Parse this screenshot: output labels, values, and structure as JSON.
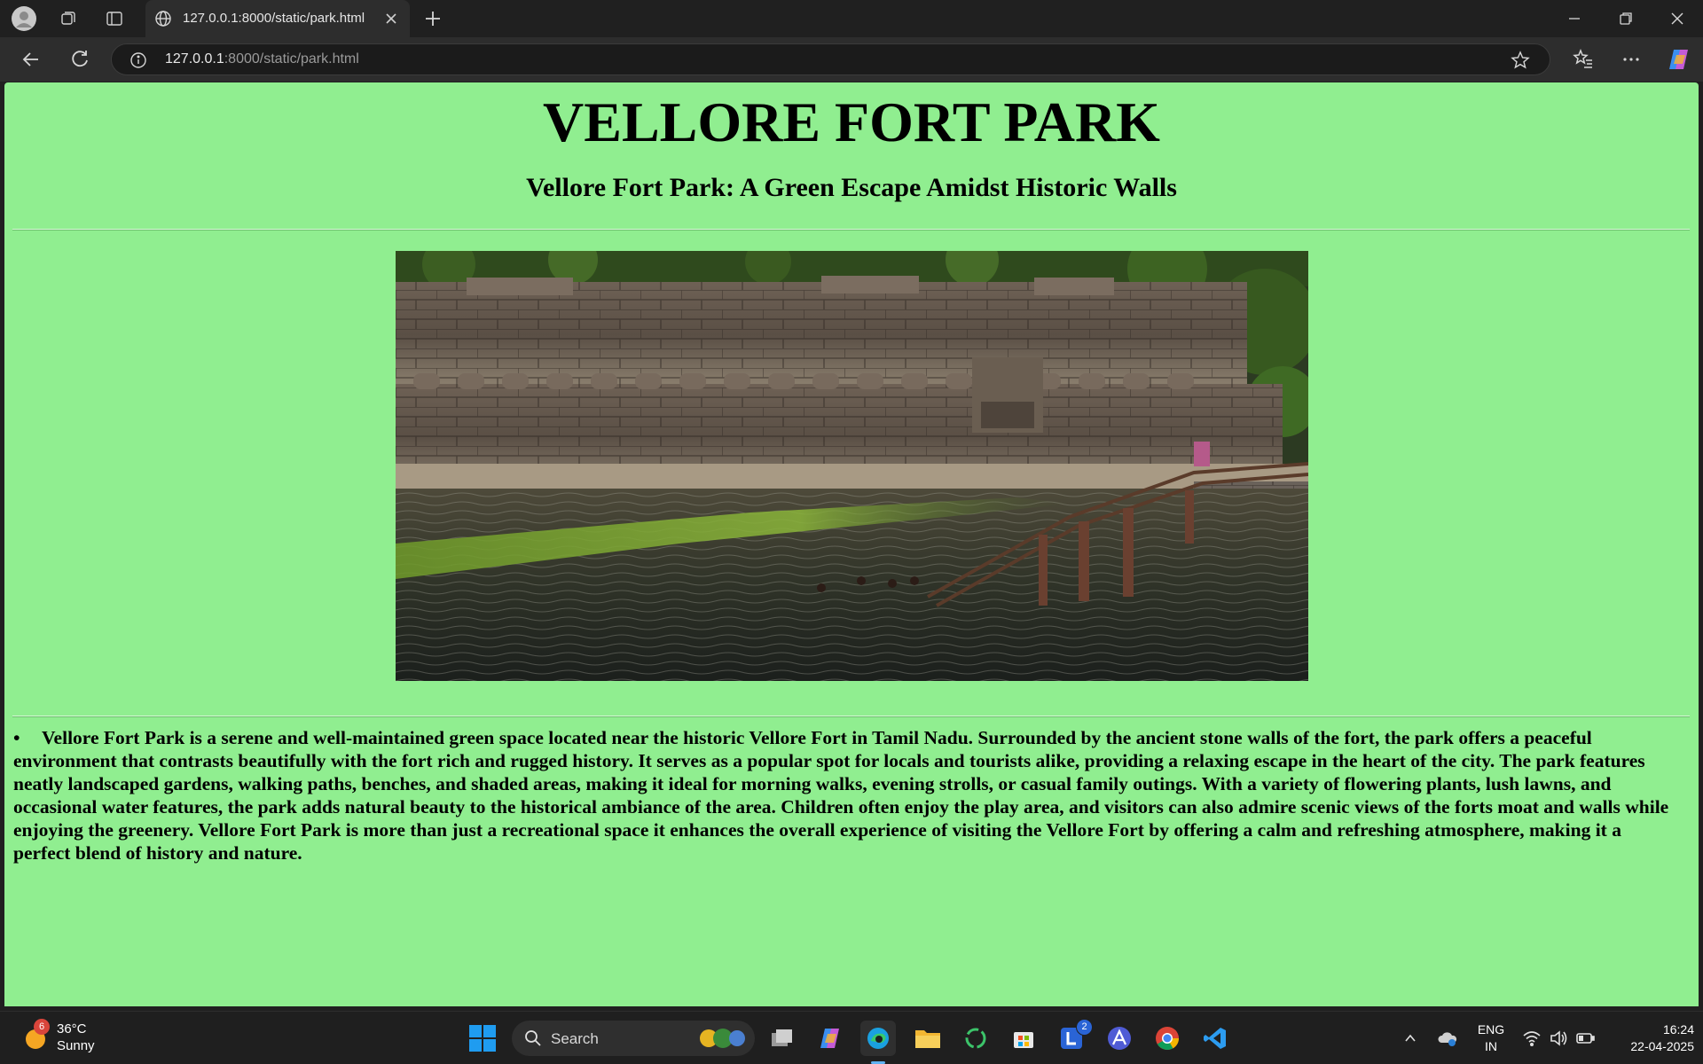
{
  "browser": {
    "tab_title": "127.0.0.1:8000/static/park.html",
    "url_host": "127.0.0.1",
    "url_path": ":8000/static/park.html"
  },
  "page": {
    "title": "VELLORE FORT PARK",
    "subtitle": "Vellore Fort Park: A Green Escape Amidst Historic Walls",
    "bullet": "•",
    "paragraph": "Vellore Fort Park is a serene and well-maintained green space located near the historic Vellore Fort in Tamil Nadu. Surrounded by the ancient stone walls of the fort, the park offers a peaceful environment that contrasts beautifully with the fort rich and rugged history. It serves as a popular spot for locals and tourists alike, providing a relaxing escape in the heart of the city. The park features neatly landscaped gardens, walking paths, benches, and shaded areas, making it ideal for morning walks, evening strolls, or casual family outings. With a variety of flowering plants, lush lawns, and occasional water features, the park adds natural beauty to the historical ambiance of the area. Children often enjoy the play area, and visitors can also admire scenic views of the forts moat and walls while enjoying the greenery. Vellore Fort Park is more than just a recreational space it enhances the overall experience of visiting the Vellore Fort by offering a calm and refreshing atmosphere, making it a perfect blend of history and nature.",
    "background_color": "#90ee90"
  },
  "taskbar": {
    "weather_temp": "36°C",
    "weather_cond": "Sunny",
    "weather_badge": "6",
    "search_label": "Search",
    "teams_badge": "2",
    "lang_top": "ENG",
    "lang_bottom": "IN",
    "time": "16:24",
    "date": "22-04-2025"
  }
}
